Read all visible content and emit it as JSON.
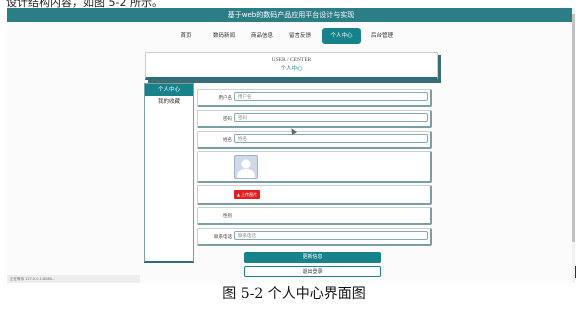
{
  "doc_top_text": "设计结构内容，如图 5-2 所示。",
  "app": {
    "title": "基于web的数码产品应用平台设计与实现"
  },
  "nav": {
    "items": [
      "首页",
      "数码新闻",
      "商品信息",
      "留言反馈",
      "个人中心",
      "后台管理"
    ],
    "active_index": 4
  },
  "center_box": {
    "title_en": "USER / CENTER",
    "title_cn": "个人中心"
  },
  "sidebar": {
    "items": [
      "个人中心",
      "我的收藏"
    ],
    "active_index": 0
  },
  "form": {
    "username_label": "用户名",
    "username_placeholder": "用户名",
    "password_label": "密码",
    "password_placeholder": "密码",
    "name_label": "姓名",
    "name_placeholder": "姓名",
    "upload_label": "上传图片",
    "gender_label": "性别",
    "phone_label": "联系电话",
    "phone_placeholder": "联系电话"
  },
  "buttons": {
    "update": "更新信息",
    "logout": "退出登录"
  },
  "status_bar": {
    "text": "正在等待 127.0.0.1:8080..."
  },
  "caption": "图 5-2 个人中心界面图",
  "colors": {
    "primary": "#17828a",
    "title_bar": "#2b7d86",
    "danger": "#e02020"
  }
}
